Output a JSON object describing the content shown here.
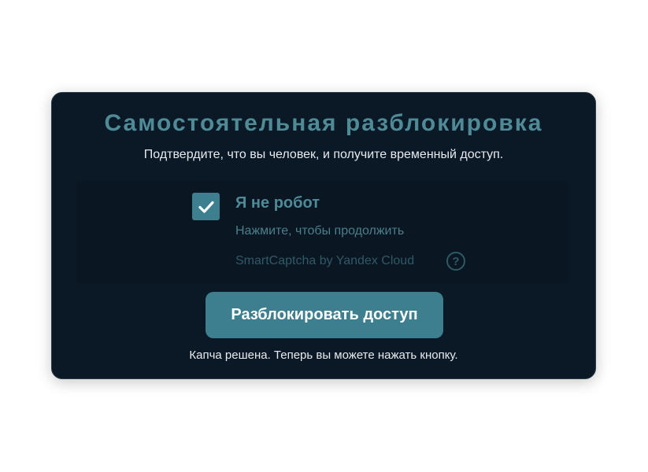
{
  "dialog": {
    "title": "Самостоятельная разблокировка",
    "subtitle": "Подтвердите, что вы человек, и получите временный доступ."
  },
  "captcha": {
    "checkbox_checked": true,
    "checkbox_icon": "checkmark-icon",
    "label": "Я не робот",
    "hint": "Нажмите, чтобы продолжить",
    "brand": "SmartCaptcha by Yandex Cloud",
    "help_symbol": "?",
    "help_icon": "question-circle-icon"
  },
  "actions": {
    "unlock_label": "Разблокировать доступ"
  },
  "status": {
    "message": "Капча решена. Теперь вы можете нажать кнопку."
  },
  "colors": {
    "card_background": "#0b1825",
    "accent": "#3d7f8f",
    "title": "#4f8a97",
    "text": "#e7ebef"
  }
}
